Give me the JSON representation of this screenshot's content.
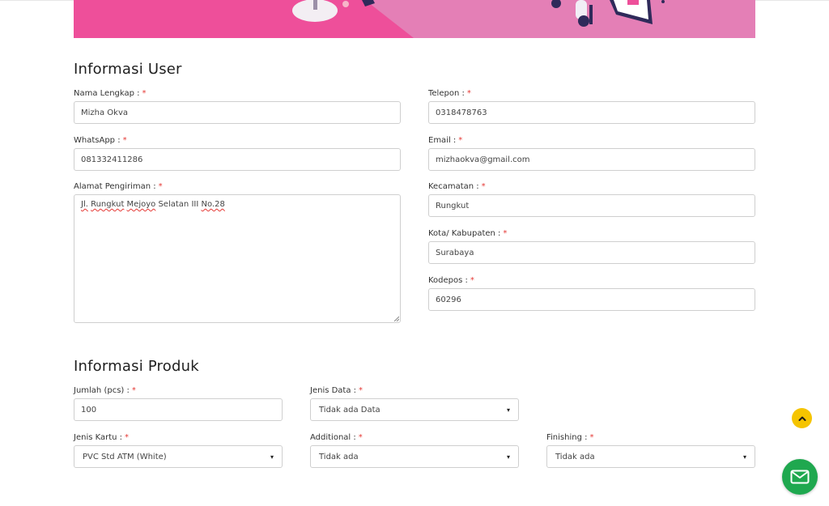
{
  "colors": {
    "accent": "#ee4f9a",
    "required": "#e53935",
    "scroll_button": "#f5c400",
    "mail_button": "#1fa84f"
  },
  "user_section": {
    "title": "Informasi User",
    "fields": {
      "nama": {
        "label": "Nama Lengkap :",
        "value": "Mizha Okva"
      },
      "whatsapp": {
        "label": "WhatsApp :",
        "value": "081332411286"
      },
      "alamat": {
        "label": "Alamat Pengiriman :",
        "value_words": [
          "Jl.",
          "Rungkut",
          "Mejoyo",
          "Selatan",
          "III",
          "No.28"
        ]
      },
      "telepon": {
        "label": "Telepon :",
        "value": "0318478763"
      },
      "email": {
        "label": "Email :",
        "value": "mizhaokva@gmail.com"
      },
      "kecamatan": {
        "label": "Kecamatan :",
        "value": "Rungkut"
      },
      "kota": {
        "label": "Kota/ Kabupaten :",
        "value": "Surabaya"
      },
      "kodepos": {
        "label": "Kodepos :",
        "value": "60296"
      }
    },
    "required_mark": "*"
  },
  "product_section": {
    "title": "Informasi Produk",
    "fields": {
      "jumlah": {
        "label": "Jumlah (pcs) :",
        "value": "100"
      },
      "jenis_data": {
        "label": "Jenis Data :",
        "selected": "Tidak ada Data"
      },
      "jenis_kartu": {
        "label": "Jenis Kartu :",
        "selected": "PVC Std ATM (White)"
      },
      "additional": {
        "label": "Additional :",
        "selected": "Tidak ada"
      },
      "finishing": {
        "label": "Finishing :",
        "selected": "Tidak ada"
      }
    }
  },
  "icons": {
    "scroll_top": "chevron-up-icon",
    "contact": "mail-icon",
    "select_caret": "▾"
  }
}
